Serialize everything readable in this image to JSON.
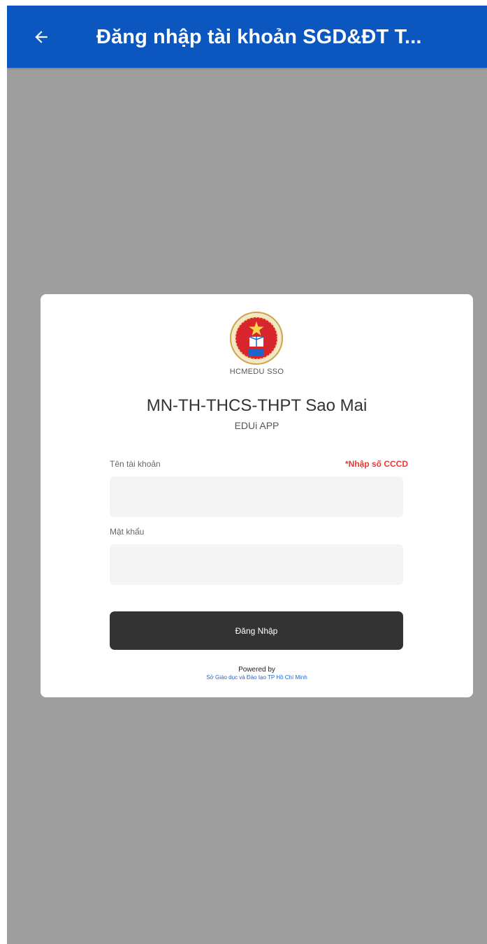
{
  "appbar": {
    "title": "Đăng nhập tài khoản SGD&ĐT T...",
    "back_icon": "arrow-left-icon",
    "color": "#0b57bf"
  },
  "card": {
    "logo_icon": "hcmedu-seal-logo",
    "sso_label": "HCMEDU SSO",
    "school_name": "MN-TH-THCS-THPT Sao Mai",
    "app_name": "EDUi APP",
    "username": {
      "label": "Tên tài khoản",
      "hint": "*Nhập số CCCD",
      "value": ""
    },
    "password": {
      "label": "Mật khẩu",
      "value": ""
    },
    "login_button": "Đăng Nhập",
    "powered_by": "Powered by",
    "powered_link": "Sở Giáo dục và Đào tạo TP Hồ Chí Minh"
  },
  "colors": {
    "overlay": "#9e9e9e",
    "button": "#333333",
    "hint": "#e53935",
    "link": "#1e66c8"
  }
}
